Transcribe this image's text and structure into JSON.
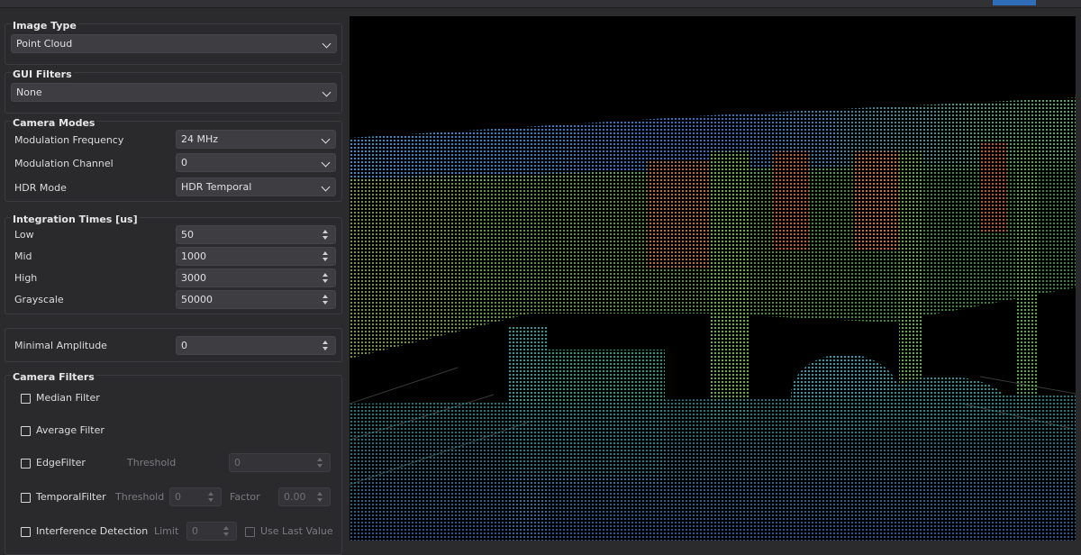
{
  "image_type": {
    "title": "Image Type",
    "value": "Point Cloud"
  },
  "gui_filters": {
    "title": "GUI Filters",
    "value": "None"
  },
  "camera_modes": {
    "title": "Camera Modes",
    "rows": [
      {
        "label": "Modulation Frequency",
        "value": "24 MHz"
      },
      {
        "label": "Modulation Channel",
        "value": "0"
      },
      {
        "label": "HDR Mode",
        "value": "HDR Temporal"
      }
    ]
  },
  "integration_times": {
    "title": "Integration Times [us]",
    "rows": [
      {
        "label": "Low",
        "value": "50"
      },
      {
        "label": "Mid",
        "value": "1000"
      },
      {
        "label": "High",
        "value": "3000"
      },
      {
        "label": "Grayscale",
        "value": "50000"
      }
    ]
  },
  "minimal_amplitude": {
    "label": "Minimal Amplitude",
    "value": "0"
  },
  "camera_filters": {
    "title": "Camera Filters",
    "median": {
      "label": "Median Filter"
    },
    "average": {
      "label": "Average Filter"
    },
    "edge": {
      "label": "EdgeFilter",
      "threshold_label": "Threshold",
      "threshold_value": "0"
    },
    "temporal": {
      "label": "TemporalFilter",
      "threshold_label": "Threshold",
      "threshold_value": "0",
      "factor_label": "Factor",
      "factor_value": "0.00"
    },
    "interference": {
      "label": "Interference Detection",
      "limit_label": "Limit",
      "limit_value": "0",
      "use_last_label": "Use Last Value"
    }
  },
  "colors": {
    "accent": "#2f6db8",
    "panel_bg": "#2b2b2e",
    "viewer_bg": "#000000"
  }
}
